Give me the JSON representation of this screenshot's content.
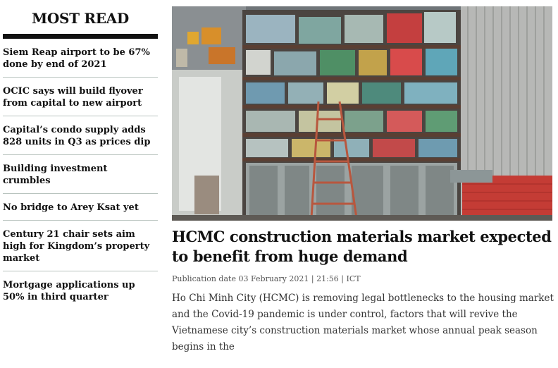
{
  "sidebar": {
    "title": "MOST READ",
    "items": [
      {
        "label": "Siem Reap airport to be 67% done by end of 2021"
      },
      {
        "label": "OCIC says will build flyover from capital to new airport"
      },
      {
        "label": "Capital’s condo supply adds 828 units in Q3 as prices dip"
      },
      {
        "label": "Building investment crumbles"
      },
      {
        "label": "No bridge to Arey Ksat yet"
      },
      {
        "label": "Century 21 chair sets aim high for Kingdom’s property market"
      },
      {
        "label": "Mortgage applications up 50% in third quarter"
      }
    ]
  },
  "article": {
    "headline": "HCMC construction materials market expected to benefit from huge demand",
    "publication": "Publication date 03 February 2021 | 21:56 | ICT",
    "lede": "Ho Chi Minh City (HCMC) is removing legal bottlenecks to the housing market and the Covid-19 pandemic is under control, factors that will revive the Vietnamese city’s construction materials market whose annual peak season begins in the"
  }
}
